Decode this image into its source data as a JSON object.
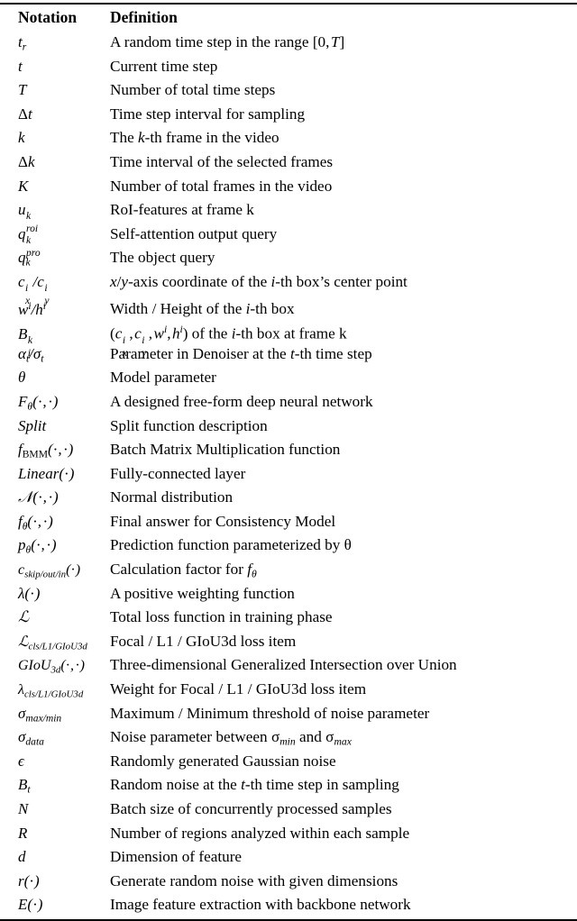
{
  "table": {
    "headers": {
      "notation": "Notation",
      "definition": "Definition"
    },
    "rows": [
      {
        "notation_plain": "t_r",
        "definition": "A random time step in the range [0, T]"
      },
      {
        "notation_plain": "t",
        "definition": "Current time step"
      },
      {
        "notation_plain": "T",
        "definition": "Number of total time steps"
      },
      {
        "notation_plain": "Δt",
        "definition": "Time step interval for sampling"
      },
      {
        "notation_plain": "k",
        "definition": "The k-th frame in the video"
      },
      {
        "notation_plain": "Δk",
        "definition": "Time interval of the selected frames"
      },
      {
        "notation_plain": "K",
        "definition": "Number of total frames in the video"
      },
      {
        "notation_plain": "u_roi^k",
        "definition": "RoI-features at frame k"
      },
      {
        "notation_plain": "q_pro^k",
        "definition": "Self-attention output query"
      },
      {
        "notation_plain": "q_k",
        "definition": "The object query"
      },
      {
        "notation_plain": "c_x^i / c_y^i",
        "definition": "x/y-axis coordinate of the i-th box's center point"
      },
      {
        "notation_plain": "w^i / h^i",
        "definition": "Width / Height of the i-th box"
      },
      {
        "notation_plain": "B_i^k",
        "definition": "(c_x^i, c_y^i, w^i, h^i) of the i-th box at frame k"
      },
      {
        "notation_plain": "α_t / σ_t",
        "definition": "Parameter in Denoiser at the t-th time step"
      },
      {
        "notation_plain": "θ",
        "definition": "Model parameter"
      },
      {
        "notation_plain": "F_θ(·, ·)",
        "definition": "A designed free-form deep neural network"
      },
      {
        "notation_plain": "Split",
        "definition": "Split function description"
      },
      {
        "notation_plain": "f_BMM(·, ·)",
        "definition": "Batch Matrix Multiplication function"
      },
      {
        "notation_plain": "Linear(·)",
        "definition": "Fully-connected layer"
      },
      {
        "notation_plain": "N(·, ·)",
        "definition": "Normal distribution"
      },
      {
        "notation_plain": "f_θ(·, ·)",
        "definition": "Final answer for Consistency Model"
      },
      {
        "notation_plain": "p_θ(·, ·)",
        "definition": "Prediction function parameterized by θ"
      },
      {
        "notation_plain": "c_skip/out/in(·)",
        "definition": "Calculation factor for f_θ"
      },
      {
        "notation_plain": "λ(·)",
        "definition": "A positive weighting function"
      },
      {
        "notation_plain": "L",
        "definition": "Total loss function in training phase"
      },
      {
        "notation_plain": "L_cls/L1/GIoU3d",
        "definition": "Focal / L1 / GIoU3d loss item"
      },
      {
        "notation_plain": "GIoU_3d(·, ·)",
        "definition": "Three-dimensional Generalized Intersection over Union"
      },
      {
        "notation_plain": "λ_cls/L1/GIoU3d",
        "definition": "Weight for Focal / L1 / GIoU3d loss item"
      },
      {
        "notation_plain": "σ_max/min",
        "definition": "Maximum / Minimum threshold of noise parameter"
      },
      {
        "notation_plain": "σ_data",
        "definition": "Noise parameter between σ_min and σ_max"
      },
      {
        "notation_plain": "ϵ",
        "definition": "Randomly generated Gaussian noise"
      },
      {
        "notation_plain": "B_t",
        "definition": "Random noise at the t-th time step in sampling"
      },
      {
        "notation_plain": "N",
        "definition": "Batch size of concurrently processed samples"
      },
      {
        "notation_plain": "R",
        "definition": "Number of regions analyzed within each sample"
      },
      {
        "notation_plain": "d",
        "definition": "Dimension of feature"
      },
      {
        "notation_plain": "r(·)",
        "definition": "Generate random noise with given dimensions"
      },
      {
        "notation_plain": "E(·)",
        "definition": "Image feature extraction with backbone network"
      }
    ]
  },
  "style": {
    "rule_color": "#000000",
    "text_color": "#000000",
    "background": "#ffffff"
  }
}
